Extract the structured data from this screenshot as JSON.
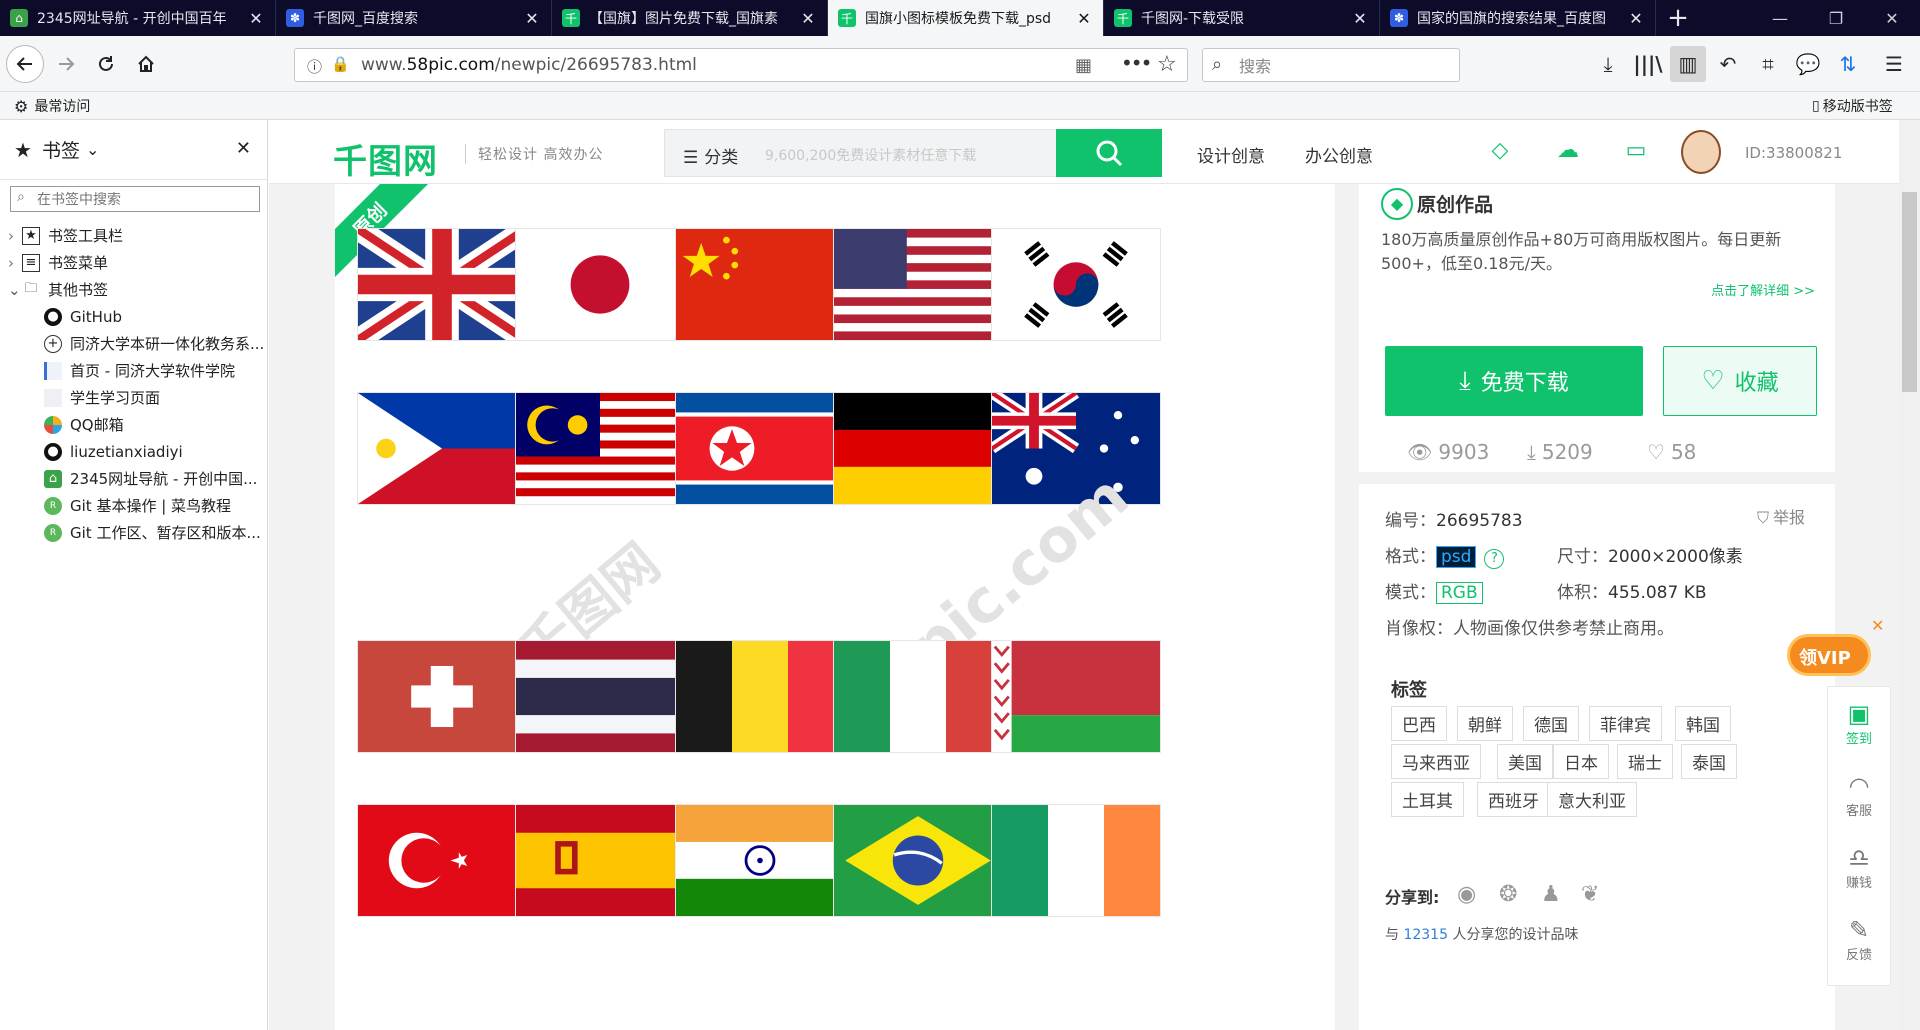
{
  "tabs": [
    {
      "title": "2345网址导航 - 开创中国百年",
      "favicon": "home-icon",
      "color": "#3aa34a"
    },
    {
      "title": "千图网_百度搜索",
      "favicon": "baidu-paw-icon",
      "color": "#2f5fe0"
    },
    {
      "title": "【国旗】图片免费下载_国旗素",
      "favicon": "qiantu-icon",
      "color": "#11c26d"
    },
    {
      "title": "国旗小图标模板免费下载_psd",
      "favicon": "qiantu-icon",
      "color": "#11c26d"
    },
    {
      "title": "千图网-下载受限",
      "favicon": "qiantu-icon",
      "color": "#11c26d"
    },
    {
      "title": "国家的国旗的搜索结果_百度图",
      "favicon": "baidu-paw-icon",
      "color": "#2f5fe0"
    }
  ],
  "url": {
    "prefix": "www.",
    "domain": "58pic.com",
    "path": "/newpic/26695783.html"
  },
  "search_placeholder": "搜索",
  "bookmarks_toolbar": {
    "most_visited": "最常访问",
    "mobile": "移动版书签"
  },
  "sidebar": {
    "title": "书签",
    "search_placeholder": "在书签中搜索",
    "folders": [
      "书签工具栏",
      "书签菜单",
      "其他书签"
    ],
    "items": [
      {
        "label": "GitHub",
        "icon": "github-icon"
      },
      {
        "label": "同济大学本研一体化教务系...",
        "icon": "globe-icon"
      },
      {
        "label": "首页 - 同济大学软件学院",
        "icon": "page-icon"
      },
      {
        "label": "学生学习页面",
        "icon": "blank-page-icon"
      },
      {
        "label": "QQ邮箱",
        "icon": "qq-mail-icon"
      },
      {
        "label": "liuzetianxiadiyi",
        "icon": "github-icon"
      },
      {
        "label": "2345网址导航 - 开创中国...",
        "icon": "home-icon"
      },
      {
        "label": "Git 基本操作 | 菜鸟教程",
        "icon": "runoob-icon"
      },
      {
        "label": "Git 工作区、暂存区和版本...",
        "icon": "runoob-icon"
      }
    ]
  },
  "site": {
    "logo": "千图网",
    "slogan": "轻松设计  高效办公",
    "category": "分类",
    "search_placeholder": "9,600,200免费设计素材任意下载",
    "nav": [
      "设计创意",
      "办公创意"
    ],
    "user_id": "ID:33800821"
  },
  "preview": {
    "ribbon": "原创",
    "watermark1": "千图网",
    "watermark2": "58pic.com"
  },
  "info": {
    "title": "原创作品",
    "desc": "180万高质量原创作品+80万可商用版权图片。每日更新 500+，低至0.18元/天。",
    "more": "点击了解详细 >>",
    "download": "免费下载",
    "favorite": "收藏",
    "views": "9903",
    "downloads": "5209",
    "likes": "58"
  },
  "meta": {
    "id_label": "编号：",
    "id": "26695783",
    "report": "举报",
    "format_label": "格式：",
    "format": "psd",
    "size_label": "尺寸：",
    "size": "2000×2000像素",
    "mode_label": "模式：",
    "mode": "RGB",
    "volume_label": "体积：",
    "volume": "455.087 KB",
    "portrait": "肖像权：人物画像仅供参考禁止商用。",
    "tags_title": "标签",
    "tags": [
      "巴西",
      "朝鲜",
      "德国",
      "菲律宾",
      "韩国",
      "马来西亚",
      "美国",
      "日本",
      "瑞士",
      "泰国",
      "土耳其",
      "西班牙",
      "意大利亚"
    ],
    "share_label": "分享到:",
    "share_pre": "与",
    "share_count": "12315",
    "share_post": "人分享您的设计品味"
  },
  "floatbar": [
    "签到",
    "客服",
    "赚钱",
    "反馈"
  ],
  "vip": "领VIP"
}
